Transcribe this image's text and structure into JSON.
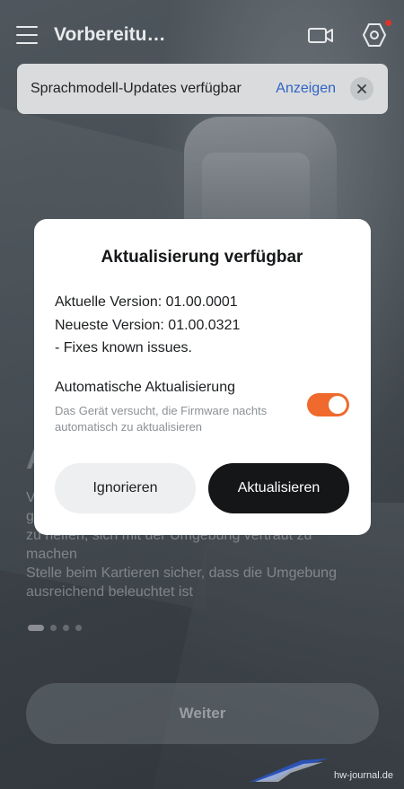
{
  "header": {
    "title": "Vorbereitu…"
  },
  "notification": {
    "text": "Sprachmodell-Updates verfügbar",
    "action": "Anzeigen"
  },
  "background": {
    "heading": "A",
    "lines": [
      "V",
      "g",
      "zu helfen, sich mit der Umgebung vertraut zu",
      "machen",
      "Stelle beim Kartieren sicher, dass die Umgebung",
      "ausreichend beleuchtet ist"
    ],
    "continue_label": "Weiter",
    "pager": {
      "count": 4,
      "active_index": 0
    }
  },
  "dialog": {
    "title": "Aktualisierung verfügbar",
    "current_version": "Aktuelle Version: 01.00.0001",
    "latest_version": "Neueste Version: 01.00.0321",
    "notes": "- Fixes known issues.",
    "auto_update": {
      "label": "Automatische Aktualisierung",
      "description": "Das Gerät versucht, die Firmware nachts automatisch zu aktualisieren",
      "enabled": true
    },
    "ignore_label": "Ignorieren",
    "update_label": "Aktualisieren"
  },
  "watermark": {
    "text": "hw-journal.de"
  },
  "colors": {
    "accent_toggle": "#ef6a2c",
    "link": "#2f63c6",
    "badge": "#e0322b",
    "primary_button": "#151617"
  },
  "icons": {
    "menu": "hamburger-icon",
    "camera": "video-camera-icon",
    "settings": "hexagon-settings-icon",
    "close": "close-icon"
  }
}
